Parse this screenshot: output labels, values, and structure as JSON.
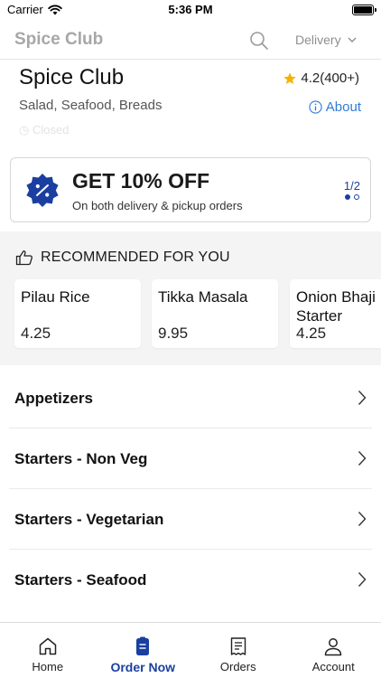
{
  "status_bar": {
    "carrier": "Carrier",
    "time": "5:36 PM"
  },
  "navbar": {
    "title": "Spice Club",
    "delivery_label": "Delivery"
  },
  "restaurant": {
    "name": "Spice Club",
    "rating": "4.2(400+)",
    "cuisine": "Salad, Seafood, Breads",
    "about_label": "About",
    "status": "Closed"
  },
  "promo": {
    "title": "GET 10% OFF",
    "subtitle": "On both delivery & pickup orders",
    "page": "1/2",
    "badge_symbol": "%"
  },
  "recommended": {
    "title": "RECOMMENDED FOR YOU",
    "items": [
      {
        "name": "Pilau Rice",
        "price": "4.25"
      },
      {
        "name": "Tikka Masala",
        "price": "9.95"
      },
      {
        "name": "Onion Bhaji Starter",
        "price": "4.25"
      }
    ]
  },
  "categories": [
    {
      "label": "Appetizers"
    },
    {
      "label": "Starters - Non Veg"
    },
    {
      "label": "Starters - Vegetarian"
    },
    {
      "label": "Starters - Seafood"
    }
  ],
  "tabbar": {
    "tabs": [
      {
        "label": "Home",
        "icon": "home-icon"
      },
      {
        "label": "Order Now",
        "icon": "order-icon",
        "active": true
      },
      {
        "label": "Orders",
        "icon": "receipt-icon"
      },
      {
        "label": "Account",
        "icon": "account-icon"
      }
    ]
  },
  "colors": {
    "accent": "#1a3fa0",
    "link": "#2f7bd6",
    "star": "#f5b300",
    "section_bg": "#f4f4f4"
  }
}
